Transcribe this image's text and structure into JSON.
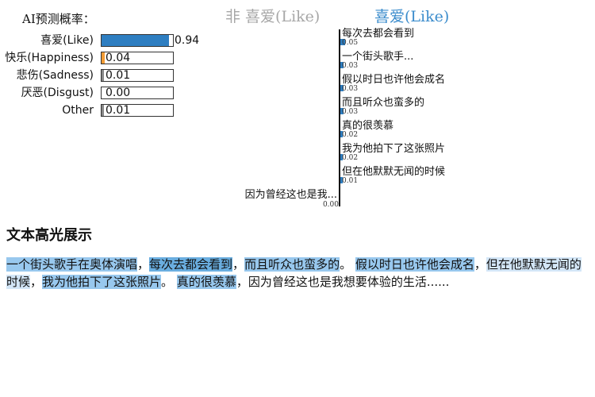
{
  "prediction": {
    "title": "AI预测概率：",
    "rows": [
      {
        "label": "喜爱(Like)",
        "value": "0.94",
        "prob": 0.94,
        "color": "#2e7ec1"
      },
      {
        "label": "快乐(Happiness)",
        "value": "0.04",
        "prob": 0.04,
        "color": "#f39c34"
      },
      {
        "label": "悲伤(Sadness)",
        "value": "0.01",
        "prob": 0.01,
        "color": "#888888"
      },
      {
        "label": "厌恶(Disgust)",
        "value": "0.00",
        "prob": 0.0,
        "color": "#888888"
      },
      {
        "label": "Other",
        "value": "0.01",
        "prob": 0.01,
        "color": "#888888"
      }
    ]
  },
  "explain": {
    "neg_header": "非 喜爱(Like)",
    "pos_header": "喜爱(Like)",
    "features": [
      {
        "text": "每次去都会看到",
        "value": "0.05",
        "weight": 0.05
      },
      {
        "text": "一个街头歌手...",
        "value": "0.03",
        "weight": 0.03
      },
      {
        "text": "假以时日也许他会成名",
        "value": "0.03",
        "weight": 0.03
      },
      {
        "text": "而且听众也蛮多的",
        "value": "0.03",
        "weight": 0.03
      },
      {
        "text": "真的很羡慕",
        "value": "0.02",
        "weight": 0.02
      },
      {
        "text": "我为他拍下了这张照片",
        "value": "0.02",
        "weight": 0.02
      },
      {
        "text": "但在他默默无闻的时候",
        "value": "0.01",
        "weight": 0.01
      },
      {
        "text": "因为曾经这也是我...",
        "value": "0.00",
        "weight": 0.0
      }
    ]
  },
  "highlight": {
    "title": "文本高光展示",
    "segments": [
      {
        "text": "一个街头歌手在奥体演唱",
        "hl": "medium"
      },
      {
        "text": "，",
        "hl": "none"
      },
      {
        "text": "每次去都会看到",
        "hl": "strong"
      },
      {
        "text": "，",
        "hl": "none"
      },
      {
        "text": "而且听众也蛮多的",
        "hl": "medium"
      },
      {
        "text": "。 ",
        "hl": "none"
      },
      {
        "text": "假以时日也许他会成名",
        "hl": "medium"
      },
      {
        "text": "，",
        "hl": "none"
      },
      {
        "text": "但在他默默无闻的时候",
        "hl": "light"
      },
      {
        "text": "，",
        "hl": "none"
      },
      {
        "text": "我为他拍下了这张照片",
        "hl": "medium"
      },
      {
        "text": "。 ",
        "hl": "none"
      },
      {
        "text": "真的很羡慕",
        "hl": "medium"
      },
      {
        "text": "，因为曾经这也是我想要体验的生活......",
        "hl": "none"
      }
    ]
  }
}
